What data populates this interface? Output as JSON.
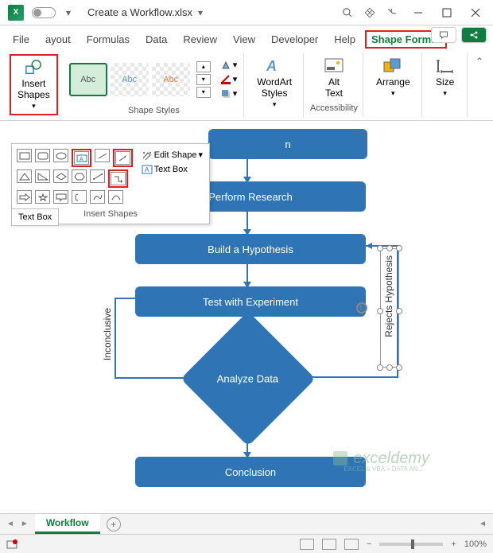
{
  "titlebar": {
    "app_letter": "X",
    "filename": "Create a Workflow.xlsx",
    "dropdown_glyph": "▾"
  },
  "tabs": {
    "file": "File",
    "layout": "ayout",
    "formulas": "Formulas",
    "data": "Data",
    "review": "Review",
    "view": "View",
    "developer": "Developer",
    "help": "Help",
    "shape_format": "Shape Format"
  },
  "ribbon": {
    "insert_shapes": "Insert\nShapes",
    "style_text": "Abc",
    "shape_styles_label": "Shape Styles",
    "wordart": "WordArt\nStyles",
    "alt_text": "Alt\nText",
    "accessibility_label": "Accessibility",
    "arrange": "Arrange",
    "size": "Size"
  },
  "popup": {
    "edit_shape": "Edit Shape",
    "text_box": "Text Box",
    "label": "Insert Shapes",
    "tooltip": "Text Box"
  },
  "flow": {
    "s1_partial": "n",
    "s2": "Perform Research",
    "s3": "Build a Hypothesis",
    "s4": "Test with Experiment",
    "s5": "Analyze Data",
    "s6": "Conclusion",
    "label_left": "Inconclusive",
    "label_right": "Rejects Hypothesis"
  },
  "sheets": {
    "active": "Workflow",
    "add": "+"
  },
  "watermark": {
    "main": "exceldemy",
    "sub": "EXCEL & VBA + DATA AN..."
  },
  "status": {
    "zoom": "100%",
    "minus": "−",
    "plus": "+"
  }
}
